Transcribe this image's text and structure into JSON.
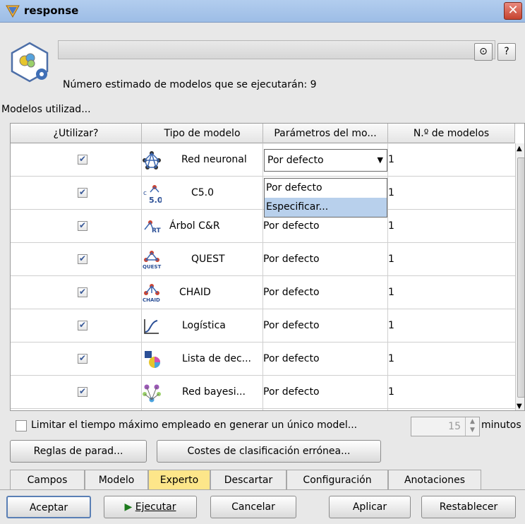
{
  "window": {
    "title": "response",
    "close": "✕"
  },
  "header": {
    "estimate": "Número estimado de modelos que se ejecutarán: 9",
    "expand_icon": "⊙",
    "help_icon": "?"
  },
  "section_label": "Modelos utilizad...",
  "table": {
    "headers": [
      "¿Utilizar?",
      "Tipo de modelo",
      "Parámetros del mo...",
      "N.º de modelos"
    ],
    "rows": [
      {
        "use": true,
        "icon": "neural-net-icon",
        "model": "Red neuronal",
        "params": "Por defecto",
        "count": "1"
      },
      {
        "use": true,
        "icon": "c50-icon",
        "model": "C5.0",
        "params": "Por defecto",
        "count": "1"
      },
      {
        "use": true,
        "icon": "cart-icon",
        "model": "Árbol C&R",
        "params": "Por defecto",
        "count": "1"
      },
      {
        "use": true,
        "icon": "quest-icon",
        "model": "QUEST",
        "params": "Por defecto",
        "count": "1"
      },
      {
        "use": true,
        "icon": "chaid-icon",
        "model": "CHAID",
        "params": "Por defecto",
        "count": "1"
      },
      {
        "use": true,
        "icon": "logistic-icon",
        "model": "Logística",
        "params": "Por defecto",
        "count": "1"
      },
      {
        "use": true,
        "icon": "decision-list-icon",
        "model": "Lista de dec...",
        "params": "Por defecto",
        "count": "1"
      },
      {
        "use": true,
        "icon": "bayes-net-icon",
        "model": "Red bayesi...",
        "params": "Por defecto",
        "count": "1"
      }
    ],
    "dropdown_options": [
      "Por defecto",
      "Especificar..."
    ]
  },
  "timeout": {
    "label": "Limitar el tiempo máximo empleado en generar un único model...",
    "value": "15",
    "unit": "minutos"
  },
  "buttons": {
    "stop_rules": "Reglas de parad...",
    "misclass_costs": "Costes de clasificación errónea...",
    "ok": "Aceptar",
    "run": "Ejecutar",
    "cancel": "Cancelar",
    "apply": "Aplicar",
    "reset": "Restablecer"
  },
  "tabs": [
    "Campos",
    "Modelo",
    "Experto",
    "Descartar",
    "Configuración",
    "Anotaciones"
  ],
  "active_tab": "Experto",
  "colors": {
    "active_tab": "#fde68a",
    "selection": "#b8d0ec",
    "title_bar": "#b2cdee"
  }
}
